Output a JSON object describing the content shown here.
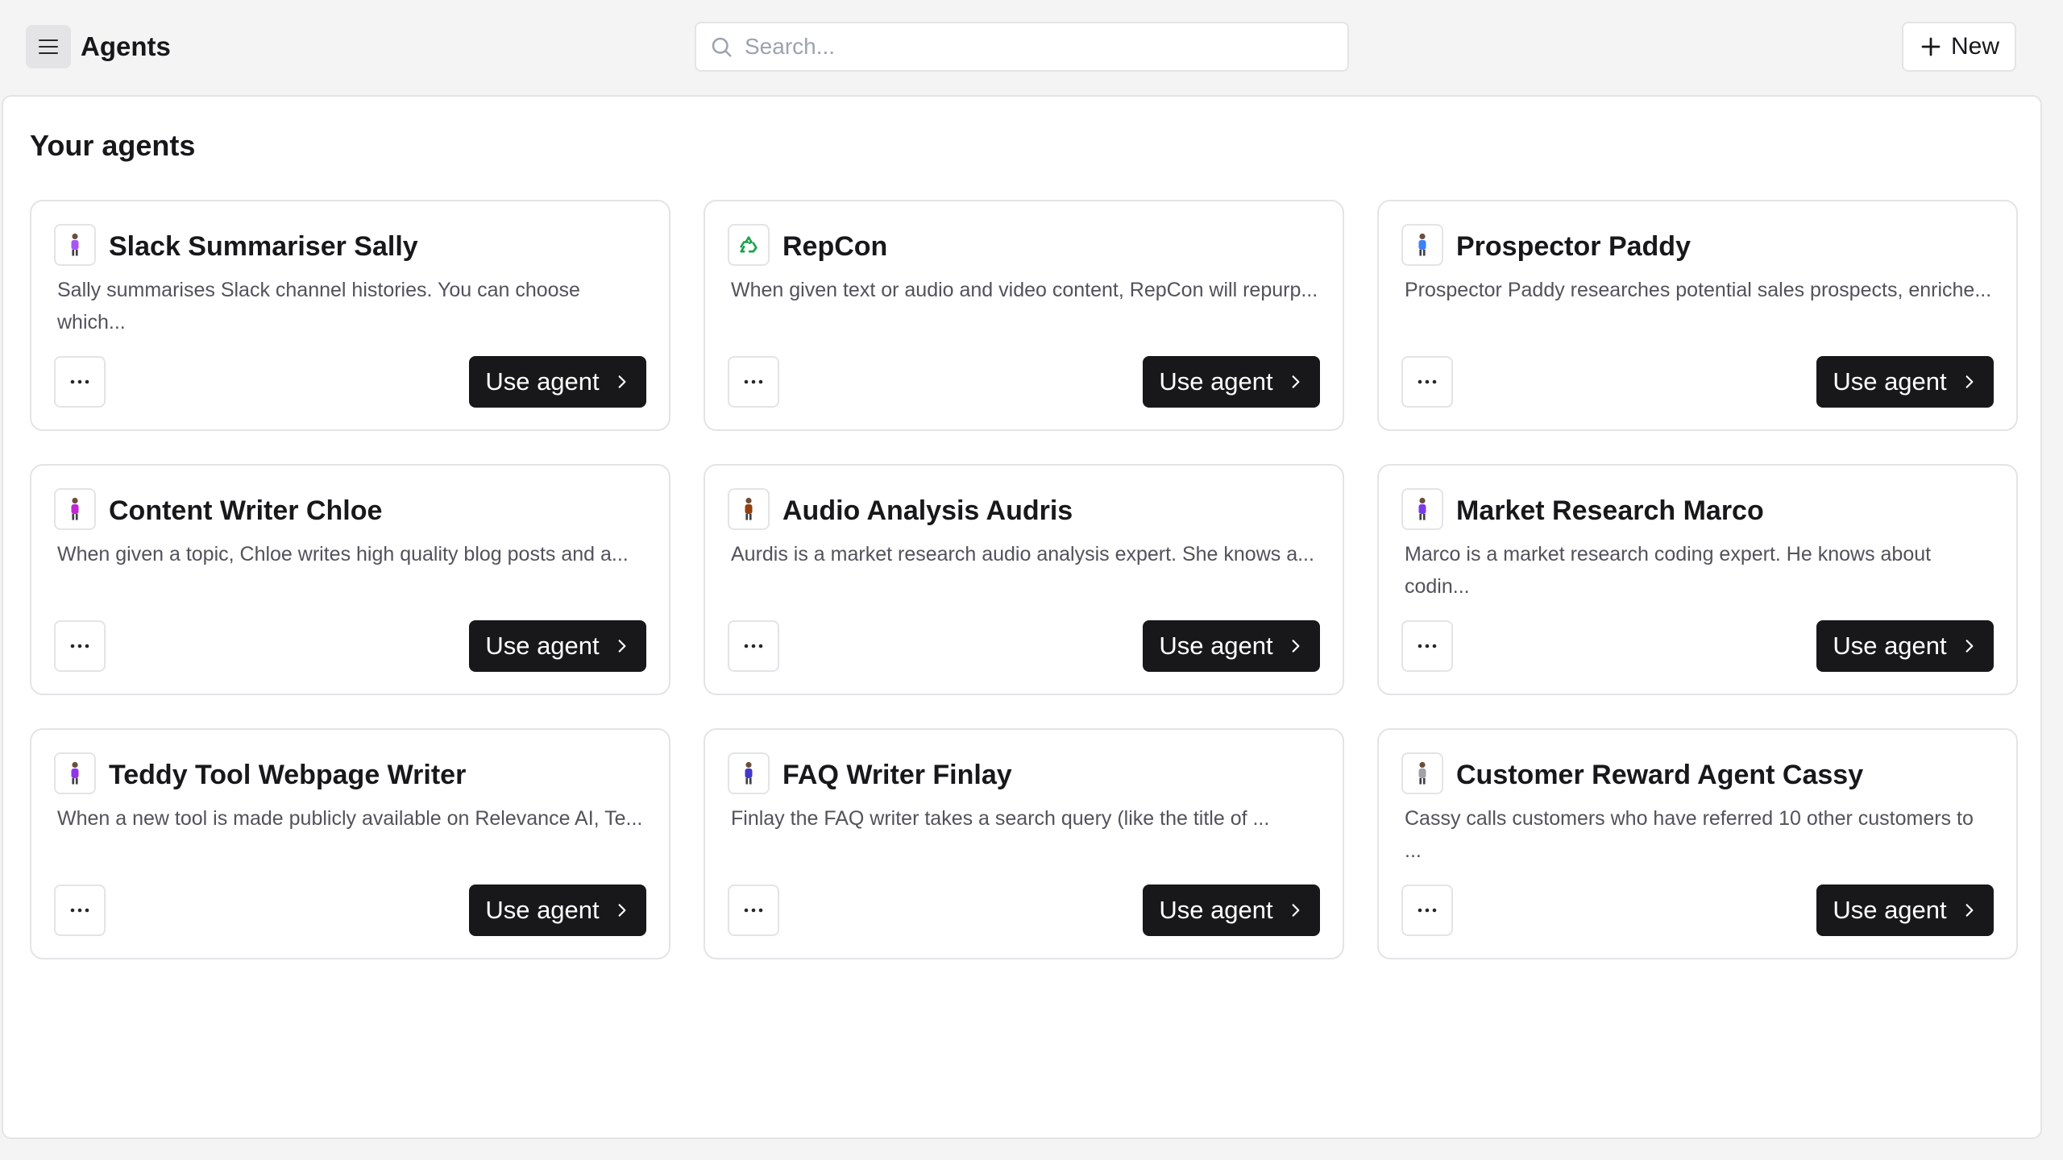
{
  "header": {
    "title": "Agents",
    "search_placeholder": "Search...",
    "new_label": "New"
  },
  "main": {
    "section_title": "Your agents",
    "use_label": "Use agent",
    "agents": [
      {
        "name": "Slack Summariser Sally",
        "desc": "Sally summarises Slack channel histories. You can choose which...",
        "avatar": "person-figure-icon",
        "color": "#a855f7"
      },
      {
        "name": "RepCon",
        "desc": "When given text or audio and video content, RepCon will repurp...",
        "avatar": "recycle-icon",
        "color": "#16a34a"
      },
      {
        "name": "Prospector Paddy",
        "desc": "Prospector Paddy researches potential sales prospects, enriche...",
        "avatar": "person-figure-icon",
        "color": "#3b82f6"
      },
      {
        "name": "Content Writer Chloe",
        "desc": "When given a topic, Chloe writes high quality blog posts and a...",
        "avatar": "person-figure-icon",
        "color": "#c026d3"
      },
      {
        "name": "Audio Analysis Audris",
        "desc": "Aurdis is a market research audio analysis expert. She knows a...",
        "avatar": "person-figure-icon",
        "color": "#92400e"
      },
      {
        "name": "Market Research Marco",
        "desc": "Marco is a market research coding expert. He knows about codin...",
        "avatar": "person-figure-icon",
        "color": "#7c3aed"
      },
      {
        "name": "Teddy Tool Webpage Writer",
        "desc": "When a new tool is made publicly available on Relevance AI, Te...",
        "avatar": "person-figure-icon",
        "color": "#9333ea"
      },
      {
        "name": "FAQ Writer Finlay",
        "desc": "Finlay the FAQ writer takes a search query (like the title of ...",
        "avatar": "person-figure-icon",
        "color": "#4338ca"
      },
      {
        "name": "Customer Reward Agent Cassy",
        "desc": "Cassy calls customers who have referred 10 other customers to ...",
        "avatar": "person-figure-icon",
        "color": "#a1a1aa"
      }
    ]
  }
}
